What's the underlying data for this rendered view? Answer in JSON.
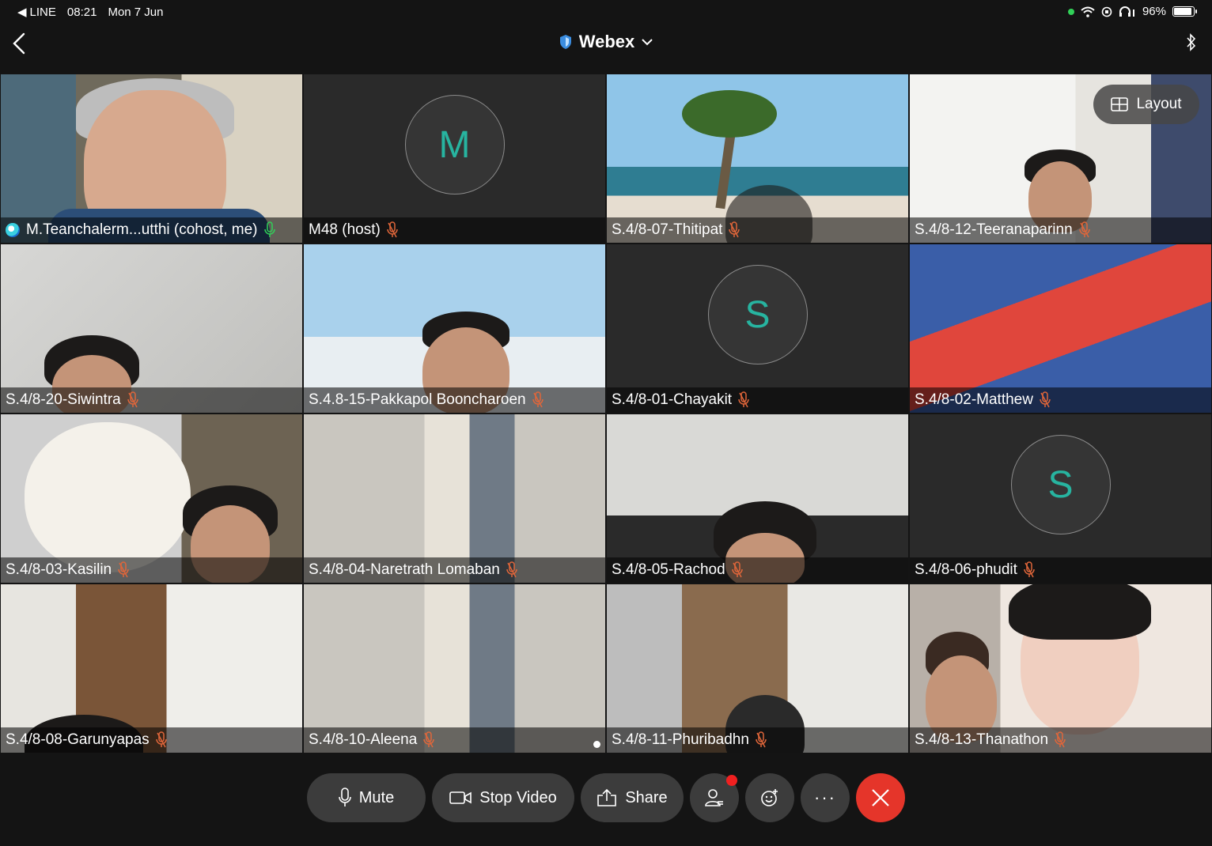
{
  "status": {
    "app": "LINE",
    "time": "08:21",
    "date": "Mon 7 Jun",
    "battery": "96%",
    "battery_level": 0.96
  },
  "header": {
    "title": "Webex"
  },
  "layout_button": "Layout",
  "participants": [
    {
      "name": "M.Teanchalerm...utthi (cohost, me)",
      "scene": "teacher",
      "mic": "on",
      "active": true
    },
    {
      "name": "M48 (host)",
      "avatar": "M",
      "mic": "muted"
    },
    {
      "name": "S.4/8-07-Thitipat",
      "scene": "beach",
      "mic": "muted"
    },
    {
      "name": "S.4/8-12-Teeranaparinn",
      "scene": "room",
      "mic": "muted"
    },
    {
      "name": "S.4/8-20-Siwintra",
      "scene": "wall",
      "mic": "muted"
    },
    {
      "name": "S.4.8-15-Pakkapol Booncharoen",
      "scene": "blue",
      "mic": "muted"
    },
    {
      "name": "S.4/8-01-Chayakit",
      "avatar": "S",
      "mic": "muted"
    },
    {
      "name": "S.4/8-02-Matthew",
      "scene": "red",
      "mic": "muted"
    },
    {
      "name": "S.4/8-03-Kasilin",
      "scene": "dog",
      "mic": "muted"
    },
    {
      "name": "S.4/8-04-Naretrath Lomaban",
      "scene": "curtain",
      "mic": "muted"
    },
    {
      "name": "S.4/8-05-Rachod",
      "scene": "ceiling",
      "mic": "muted"
    },
    {
      "name": "S.4/8-06-phudit",
      "avatar": "S",
      "mic": "muted"
    },
    {
      "name": "S.4/8-08-Garunyapas",
      "scene": "office",
      "mic": "muted"
    },
    {
      "name": "S.4/8-10-Aleena",
      "scene": "curtain",
      "mic": "muted"
    },
    {
      "name": "S.4/8-11-Phuribadhn",
      "scene": "stairs",
      "mic": "muted"
    },
    {
      "name": "S.4/8-13-Thanathon",
      "scene": "kpop",
      "mic": "muted"
    }
  ],
  "toolbar": {
    "mute": "Mute",
    "stop_video": "Stop Video",
    "share": "Share"
  },
  "colors": {
    "accent_teal": "#27b4a0",
    "end_red": "#e5352a",
    "muted_icon": "#e0663a",
    "active_border": "#3aa0d8"
  }
}
